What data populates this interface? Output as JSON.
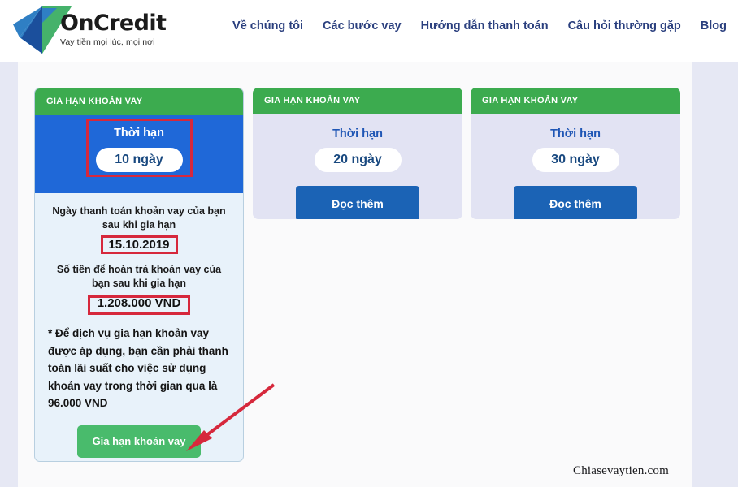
{
  "header": {
    "logo": {
      "name": "OnCredit",
      "tagline": "Vay tiền mọi lúc, mọi nơi",
      "mark_icon": "oncredit-arrow-logo",
      "blue": "#1b4f9c",
      "green": "#45b26b"
    },
    "nav": [
      {
        "label": "Về chúng tôi"
      },
      {
        "label": "Các bước vay"
      },
      {
        "label": "Hướng dẫn thanh toán"
      },
      {
        "label": "Câu hỏi thường gặp"
      },
      {
        "label": "Blog"
      }
    ]
  },
  "cards": [
    {
      "header": "GIA HẠN KHOẢN VAY",
      "term_label": "Thời hạn",
      "term_value": "10 ngày",
      "repay_date_label": "Ngày thanh toán khoản vay của bạn sau khi gia hạn",
      "repay_date_value": "15.10.2019",
      "repay_amount_label": "Số tiền để hoàn trả khoản vay của bạn sau khi gia hạn",
      "repay_amount_value": "1.208.000 VND",
      "note": "* Để dịch vụ gia hạn khoản vay được áp dụng, bạn cần phải thanh toán lãi suất cho việc sử dụng khoản vay trong thời gian qua là 96.000 VND",
      "action_label": "Gia hạn khoản vay"
    },
    {
      "header": "GIA HẠN KHOẢN VAY",
      "term_label": "Thời hạn",
      "term_value": "20 ngày",
      "action_label": "Đọc thêm"
    },
    {
      "header": "GIA HẠN KHOẢN VAY",
      "term_label": "Thời hạn",
      "term_value": "30 ngày",
      "action_label": "Đọc thêm"
    }
  ],
  "annotations": {
    "color": "#d6283c",
    "arrow_icon": "red-arrow-pointing-to-extend-button"
  },
  "watermark": "Chiasevaytien.com"
}
